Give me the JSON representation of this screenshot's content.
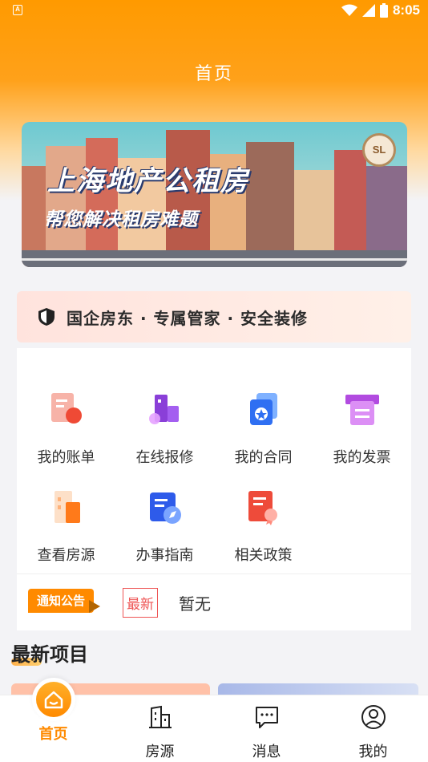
{
  "status_bar": {
    "time": "8:05",
    "left_badge": "A"
  },
  "header": {
    "title": "首页"
  },
  "banner": {
    "title": "上海地产公租房",
    "subtitle": "帮您解决租房难题",
    "logo_text": "SL"
  },
  "slogan": {
    "text": "国企房东 · 专属管家 · 安全装修"
  },
  "menu": {
    "items": [
      {
        "label": "我的账单",
        "icon": "bill-icon"
      },
      {
        "label": "在线报修",
        "icon": "repair-icon"
      },
      {
        "label": "我的合同",
        "icon": "contract-icon"
      },
      {
        "label": "我的发票",
        "icon": "invoice-icon"
      },
      {
        "label": "查看房源",
        "icon": "building-icon"
      },
      {
        "label": "办事指南",
        "icon": "guide-icon"
      },
      {
        "label": "相关政策",
        "icon": "policy-icon"
      }
    ]
  },
  "notice": {
    "badge": "通知公告",
    "new_label": "最新",
    "text": "暂无"
  },
  "section": {
    "title": "最新项目"
  },
  "bottom_nav": {
    "items": [
      {
        "label": "首页",
        "icon": "home-icon",
        "active": true
      },
      {
        "label": "房源",
        "icon": "building-icon"
      },
      {
        "label": "消息",
        "icon": "message-icon"
      },
      {
        "label": "我的",
        "icon": "user-icon"
      }
    ]
  },
  "colors": {
    "accent": "#ff8a00",
    "header_top": "#ff9a00",
    "new_tag": "#ee5555"
  }
}
